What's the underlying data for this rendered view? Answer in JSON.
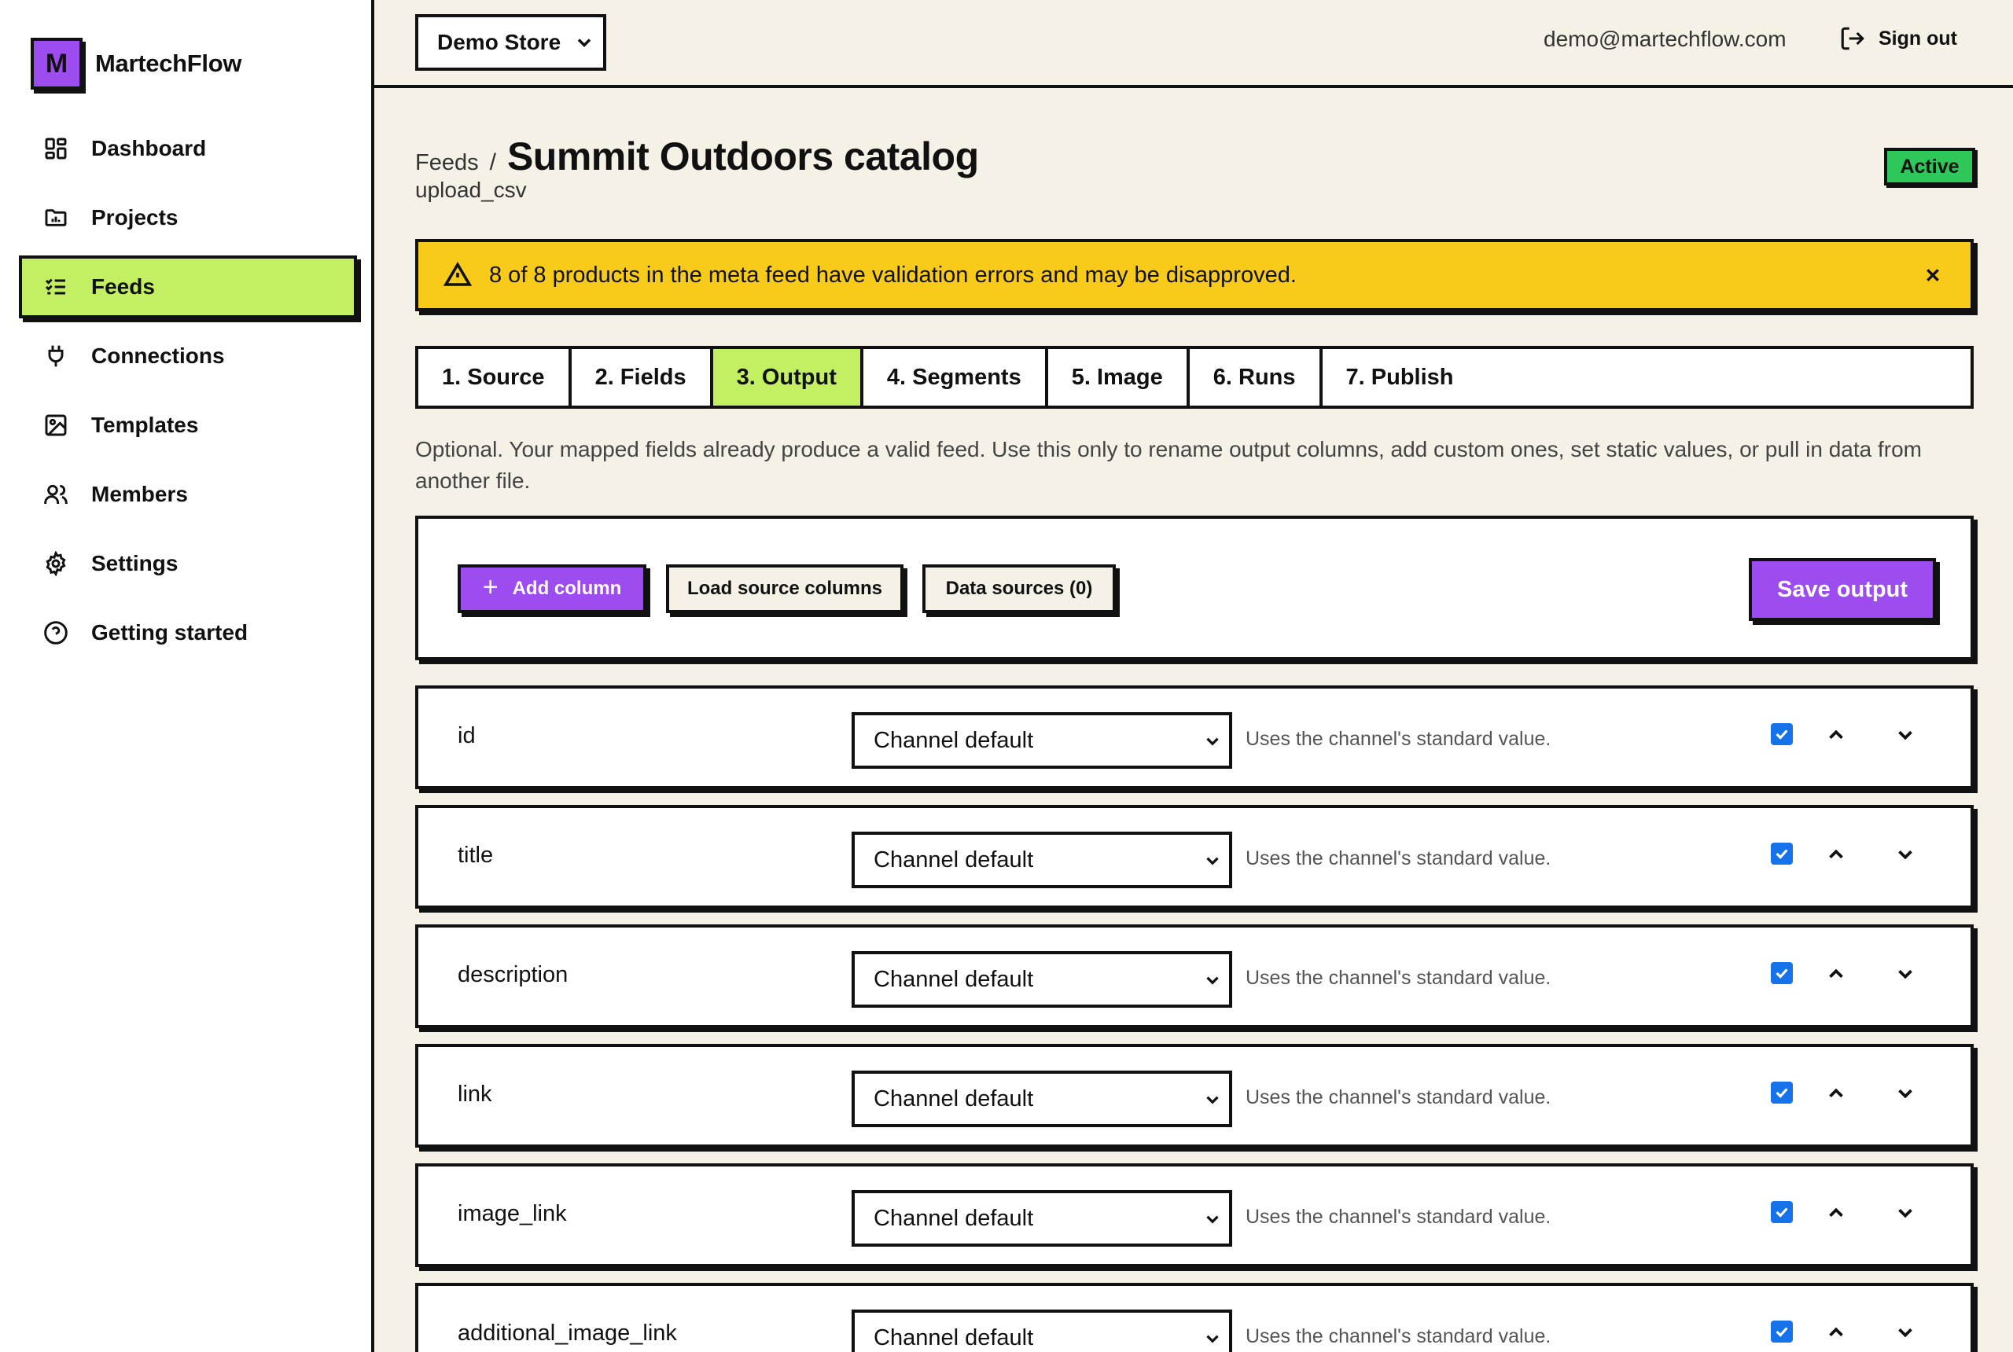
{
  "brand": {
    "logo_letter": "M",
    "name": "MartechFlow",
    "accent": "#9d4cf0"
  },
  "sidebar": {
    "items": [
      {
        "label": "Dashboard",
        "icon": "dashboard-grid-icon"
      },
      {
        "label": "Projects",
        "icon": "folder-chart-icon"
      },
      {
        "label": "Feeds",
        "icon": "list-check-icon",
        "active": true
      },
      {
        "label": "Connections",
        "icon": "plug-icon"
      },
      {
        "label": "Templates",
        "icon": "image-template-icon"
      },
      {
        "label": "Members",
        "icon": "users-icon"
      },
      {
        "label": "Settings",
        "icon": "gear-icon"
      },
      {
        "label": "Getting started",
        "icon": "help-circle-icon"
      }
    ],
    "active_color": "#c2f062"
  },
  "topbar": {
    "store_select": "Demo Store",
    "user_email": "demo@martechflow.com",
    "signout_label": "Sign out"
  },
  "header": {
    "breadcrumb_parent": "Feeds",
    "breadcrumb_sep": "/",
    "title": "Summit Outdoors catalog",
    "subtitle": "upload_csv",
    "status": "Active",
    "status_color": "#2ec759"
  },
  "alert": {
    "text": "8 of 8 products in the meta feed have validation errors and may be disapproved.",
    "color": "#f8ca1a"
  },
  "tabs": [
    {
      "label": "1. Source"
    },
    {
      "label": "2. Fields"
    },
    {
      "label": "3. Output",
      "active": true
    },
    {
      "label": "4. Segments"
    },
    {
      "label": "5. Image"
    },
    {
      "label": "6. Runs"
    },
    {
      "label": "7. Publish"
    }
  ],
  "help_text": "Optional. Your mapped fields already produce a valid feed. Use this only to rename output columns, add custom ones, set static values, or pull in data from another file.",
  "toolbar": {
    "add_column": "Add column",
    "load_source": "Load source columns",
    "data_sources": "Data sources (0)",
    "save_output": "Save output"
  },
  "rows": [
    {
      "name": "id",
      "mode": "Channel default",
      "hint": "Uses the channel's standard value.",
      "enabled": true
    },
    {
      "name": "title",
      "mode": "Channel default",
      "hint": "Uses the channel's standard value.",
      "enabled": true
    },
    {
      "name": "description",
      "mode": "Channel default",
      "hint": "Uses the channel's standard value.",
      "enabled": true
    },
    {
      "name": "link",
      "mode": "Channel default",
      "hint": "Uses the channel's standard value.",
      "enabled": true
    },
    {
      "name": "image_link",
      "mode": "Channel default",
      "hint": "Uses the channel's standard value.",
      "enabled": true
    },
    {
      "name": "additional_image_link",
      "mode": "Channel default",
      "hint": "Uses the channel's standard value.",
      "enabled": true
    }
  ]
}
